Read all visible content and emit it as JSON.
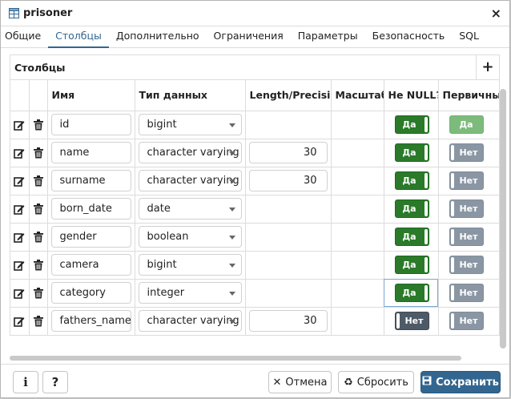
{
  "window": {
    "title": "prisoner",
    "close": "×"
  },
  "tabs": [
    "Общие",
    "Столбцы",
    "Дополнительно",
    "Ограничения",
    "Параметры",
    "Безопасность",
    "SQL"
  ],
  "active_tab": "Столбцы",
  "section": {
    "title": "Столбцы",
    "add": "+"
  },
  "columns_header": {
    "name": "Имя",
    "type": "Тип данных",
    "length": "Length/Precision",
    "scale": "Масштаб",
    "not_null": "Не NULL?",
    "primary": "Первичный"
  },
  "rows": [
    {
      "name": "id",
      "type": "bigint",
      "length": "",
      "scale": "",
      "not_null": "Да",
      "primary": "Да"
    },
    {
      "name": "name",
      "type": "character varying",
      "length": "30",
      "scale": "",
      "not_null": "Да",
      "primary": "Нет"
    },
    {
      "name": "surname",
      "type": "character varying",
      "length": "30",
      "scale": "",
      "not_null": "Да",
      "primary": "Нет"
    },
    {
      "name": "born_date",
      "type": "date",
      "length": "",
      "scale": "",
      "not_null": "Да",
      "primary": "Нет"
    },
    {
      "name": "gender",
      "type": "boolean",
      "length": "",
      "scale": "",
      "not_null": "Да",
      "primary": "Нет"
    },
    {
      "name": "camera",
      "type": "bigint",
      "length": "",
      "scale": "",
      "not_null": "Да",
      "primary": "Нет"
    },
    {
      "name": "category",
      "type": "integer",
      "length": "",
      "scale": "",
      "not_null": "Да",
      "primary": "Нет"
    },
    {
      "name": "fathers_name",
      "type": "character varying",
      "length": "30",
      "scale": "",
      "not_null": "Нет",
      "primary": "Нет"
    }
  ],
  "footer": {
    "info": "i",
    "help": "?",
    "cancel": "Отмена",
    "reset": "Сбросить",
    "save": "Сохранить"
  },
  "colors": {
    "accent": "#326690",
    "toggle_on": "#2a7a2a",
    "toggle_off": "#4e5a66"
  }
}
